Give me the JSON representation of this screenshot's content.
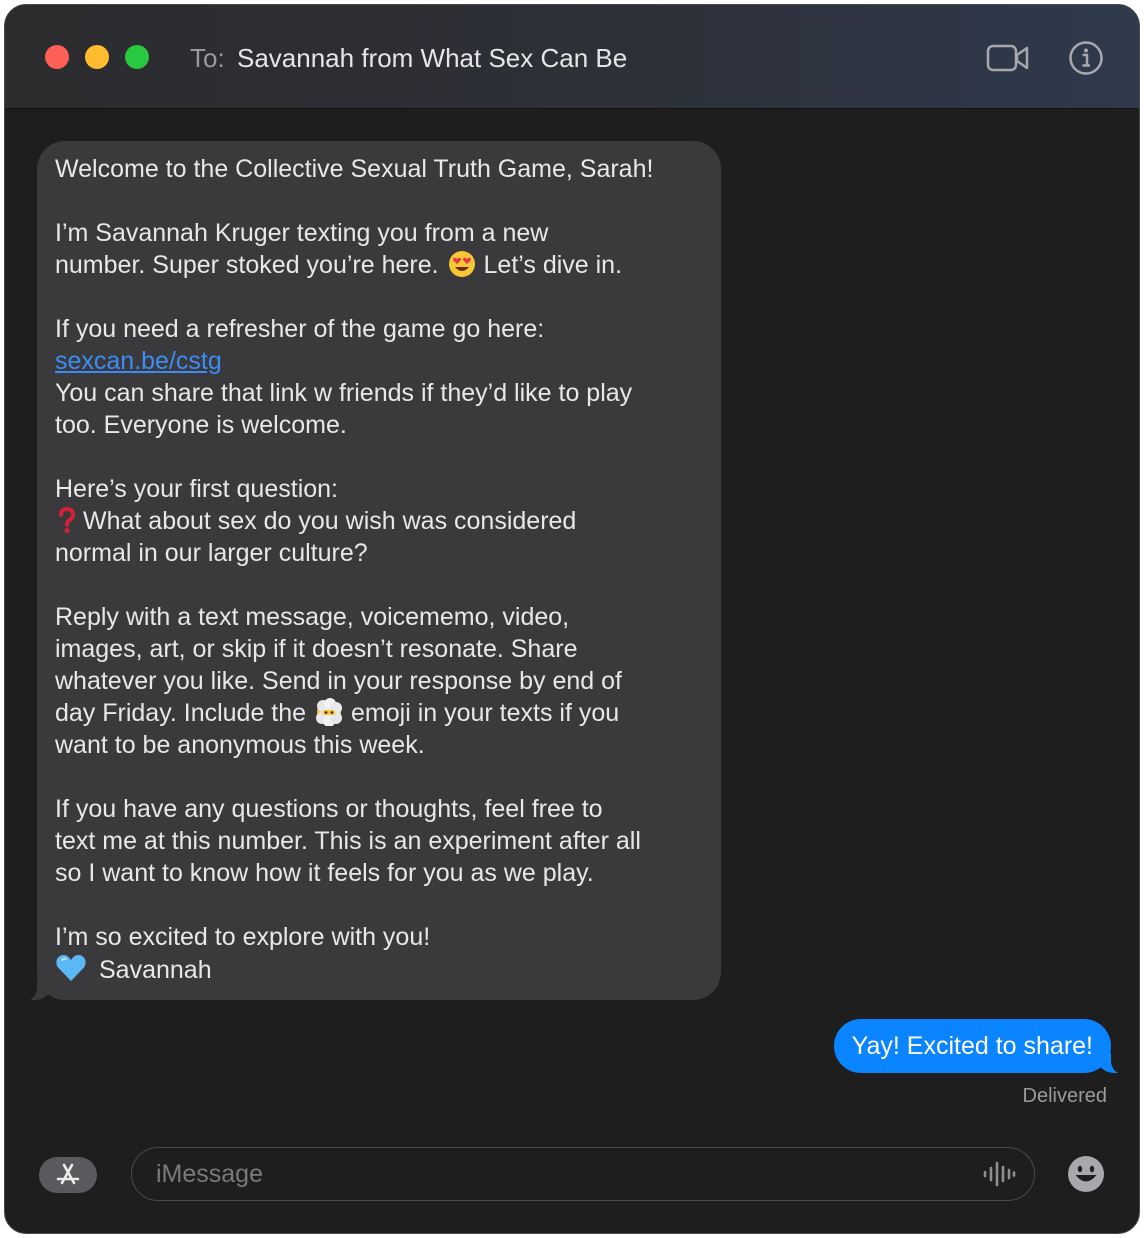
{
  "header": {
    "to_label": "To:",
    "recipient": "Savannah from What Sex Can Be"
  },
  "incoming_message": {
    "paragraphs": [
      [
        "Welcome to the Collective Sexual Truth Game, Sarah!"
      ],
      [
        "I’m Savannah Kruger texting you from a new",
        "number. Super stoked you’re here."
      ],
      [
        "If you need a refresher of the game go here:"
      ],
      [
        "Here’s your first question:",
        "What about sex do you wish was considered",
        "normal in our larger culture?"
      ],
      [
        "Reply with a text message, voicememo, video,",
        "images, art, or skip if it doesn’t resonate. Share",
        "whatever you like. Send in your response by end of",
        "day Friday. Include the",
        "want to be anonymous this week."
      ],
      [
        "If you have any questions or thoughts, feel free to",
        "text me at this number. This is an experiment after all",
        "so I want to know how it feels for you as we play."
      ],
      [
        "I’m so excited to explore with you!",
        "Savannah"
      ]
    ],
    "line2_suffix": "Let’s dive in.",
    "link_text": "sexcan.be/cstg",
    "after_link": [
      "You can share that link w friends if they’d like to play",
      "too. Everyone is welcome."
    ],
    "emoji_suffix": "emoji in your texts if you"
  },
  "outgoing_message": {
    "text": "Yay! Excited to share!",
    "status": "Delivered"
  },
  "composer": {
    "placeholder": "iMessage"
  },
  "icons": {
    "heart_eyes": "heart-eyes-emoji",
    "question": "red-question-emoji",
    "face_in_clouds": "face-in-clouds-emoji",
    "blue_heart": "blue-heart-emoji"
  },
  "colors": {
    "incoming_bubble": "#3a3a3c",
    "outgoing_bubble": "#0b84ff",
    "link": "#3c8cf7"
  }
}
